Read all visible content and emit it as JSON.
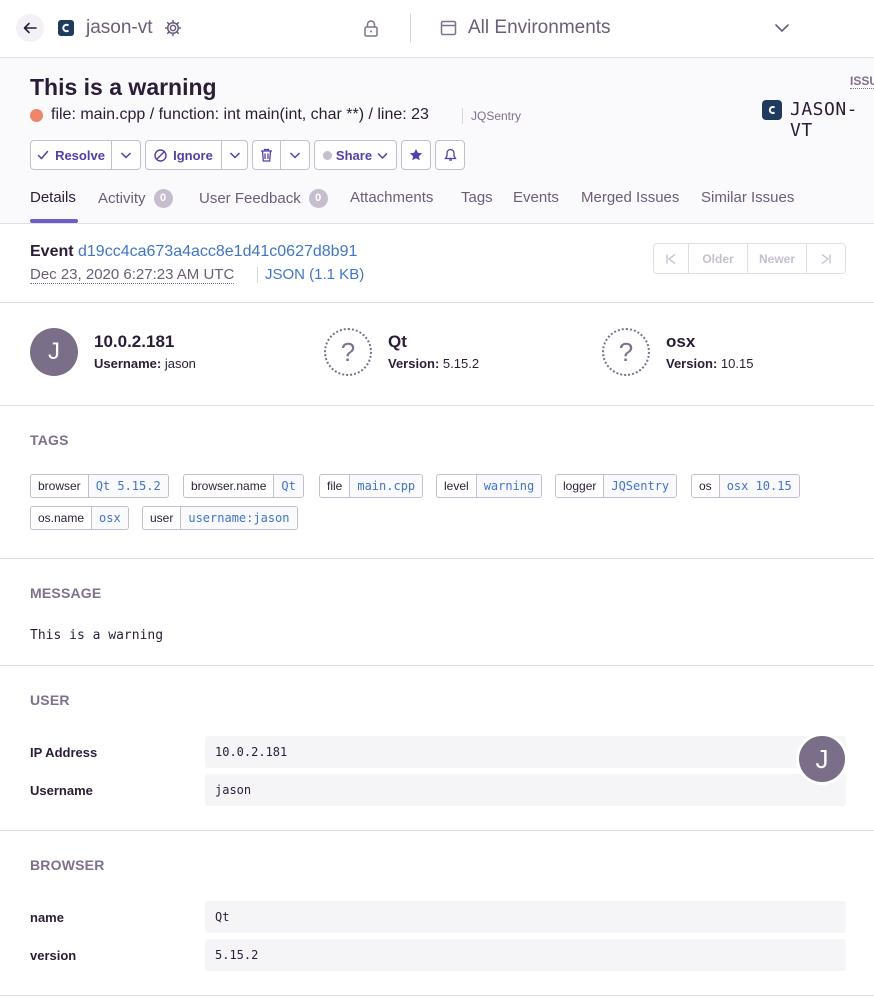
{
  "header": {
    "project_name": "jason-vt",
    "environment": "All Environments"
  },
  "issue": {
    "title": "This is a warning",
    "culprit": "file: main.cpp / function: int main(int, char **) / line: 23",
    "logger": "JQSentry",
    "id_label": "ISSU",
    "short_id": "JASON-VT",
    "level_color": "#f0856b"
  },
  "actions": {
    "resolve": "Resolve",
    "ignore": "Ignore",
    "share": "Share"
  },
  "tabs": [
    {
      "label": "Details",
      "active": true
    },
    {
      "label": "Activity",
      "badge": "0"
    },
    {
      "label": "User Feedback",
      "badge": "0"
    },
    {
      "label": "Attachments"
    },
    {
      "label": "Tags"
    },
    {
      "label": "Events"
    },
    {
      "label": "Merged Issues"
    },
    {
      "label": "Similar Issues"
    }
  ],
  "event": {
    "label": "Event",
    "id": "d19cc4ca673a4acc8e1d41c0627d8b91",
    "date": "Dec 23, 2020 6:27:23 AM UTC",
    "json_link": "JSON (1.1 KB)",
    "pager": {
      "older": "Older",
      "newer": "Newer"
    }
  },
  "context": {
    "user": {
      "initial": "J",
      "title": "10.0.2.181",
      "sub_label": "Username:",
      "sub_value": "jason"
    },
    "browser": {
      "glyph": "?",
      "title": "Qt",
      "sub_label": "Version:",
      "sub_value": "5.15.2"
    },
    "os": {
      "glyph": "?",
      "title": "osx",
      "sub_label": "Version:",
      "sub_value": "10.15"
    }
  },
  "tags_section": {
    "title": "TAGS",
    "tags": [
      {
        "key": "browser",
        "value": "Qt 5.15.2"
      },
      {
        "key": "browser.name",
        "value": "Qt"
      },
      {
        "key": "file",
        "value": "main.cpp"
      },
      {
        "key": "level",
        "value": "warning"
      },
      {
        "key": "logger",
        "value": "JQSentry"
      },
      {
        "key": "os",
        "value": "osx 10.15"
      },
      {
        "key": "os.name",
        "value": "osx"
      },
      {
        "key": "user",
        "value": "username:jason"
      }
    ]
  },
  "message_section": {
    "title": "MESSAGE",
    "text": "This is a warning"
  },
  "user_section": {
    "title": "USER",
    "avatar_initial": "J",
    "rows": [
      {
        "key": "IP Address",
        "value": "10.0.2.181"
      },
      {
        "key": "Username",
        "value": "jason"
      }
    ]
  },
  "browser_section": {
    "title": "BROWSER",
    "rows": [
      {
        "key": "name",
        "value": "Qt"
      },
      {
        "key": "version",
        "value": "5.15.2"
      }
    ]
  },
  "icons": {
    "back": "arrow-left-icon",
    "settings": "gear-icon",
    "lock": "lock-icon",
    "calendar": "calendar-icon",
    "chevron": "chevron-down-icon",
    "resolve": "checkmark-icon",
    "ignore": "ignore-icon",
    "delete": "trash-icon",
    "bookmark": "star-icon",
    "subscribe": "bell-icon"
  },
  "colors": {
    "accent": "#6c5fc7",
    "link": "#3d74db",
    "text": "#2b1d38",
    "muted": "#80708f"
  }
}
